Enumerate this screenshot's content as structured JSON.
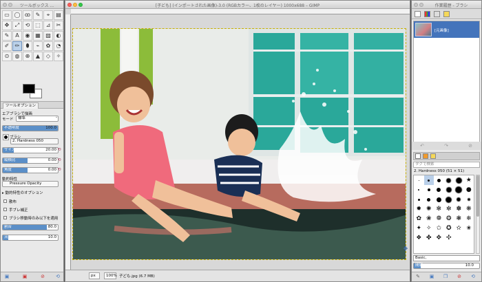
{
  "toolbox": {
    "title": "ツールボックス ...",
    "tools": [
      "▭",
      "◯",
      "ꝏ",
      "✎",
      "⌖",
      "▤",
      "✥",
      "⤢",
      "⟲",
      "⬚",
      "⊿",
      "✂",
      "✎",
      "A",
      "◉",
      "▦",
      "▨",
      "◐",
      "✐",
      "✏",
      "⬮",
      "⌁",
      "✿",
      "◔",
      "⊙",
      "◍",
      "⊕",
      "▲",
      "◇",
      "✧"
    ],
    "selected_tool_index": 19,
    "options_tab": "ツールオプション",
    "tool_name": "エアブラシで描画",
    "mode_label": "モード",
    "mode_value": "標準",
    "opacity_label": "不透明度",
    "opacity_value": "100.0",
    "brush_label": "ブラシ",
    "brush_value": "2. Hardness 050",
    "size_label": "サイズ",
    "size_value": "20.00",
    "aspect_label": "縦横比",
    "aspect_value": "0.00",
    "angle_label": "角度",
    "angle_value": "0.00",
    "dynamics_label": "動的特性",
    "dynamics_value": "Pressure Opacity",
    "dynamics_options_label": "動的特性のオプション",
    "scatter_label": "散布",
    "smooth_label": "手ブレ補正",
    "hard_label": "ブラシ移動時のみ以下を適用",
    "rate_label": "割合",
    "rate_value": "80.0",
    "flow_label": "流量",
    "flow_value": "10.0",
    "opacity_fraction": 1.0,
    "size_fraction": 0.2,
    "rate_fraction": 0.8,
    "flow_fraction": 0.1
  },
  "imagewin": {
    "title": "[子ども] (インポートされた画像)-3.0 (RGBカラー、1枚のレイヤー) 1000x688 – GIMP",
    "unit": "px",
    "zoom": "100%",
    "status_text": "子ども.jpg (6.7 MB)"
  },
  "brushwin": {
    "title": "作業履歴 - ブラシ",
    "history_item": "[元画像]",
    "filter_placeholder": "タグで検索",
    "brush_name": "2. Hardness 050 (51 × 51)",
    "preset": "Basic,",
    "spacing_label": "間隔",
    "spacing_value": "10.0",
    "spacing_fraction": 0.1
  },
  "colors": {
    "accent": "#5b8fc8",
    "selection": "#4474bb",
    "foreground": "#000000",
    "background": "#ffffff"
  }
}
